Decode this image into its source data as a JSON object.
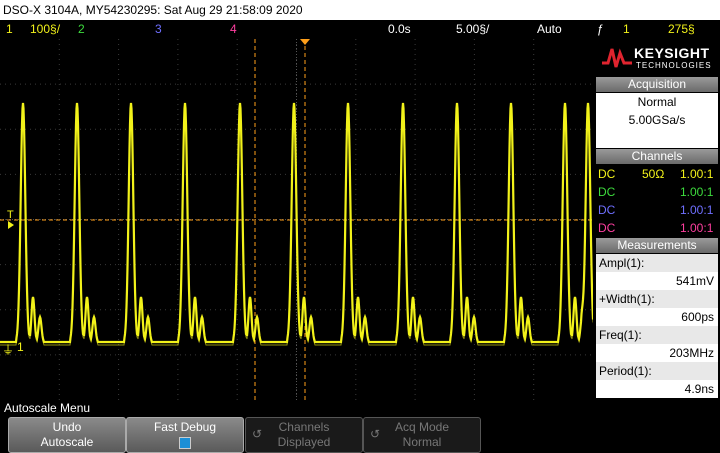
{
  "titlebar": {
    "text": "DSO-X 3104A, MY54230295: Sat Aug 29 21:58:09 2020"
  },
  "status": {
    "ch1_num": "1",
    "ch1_scale": "100§/",
    "ch2_num": "2",
    "ch3_num": "3",
    "ch4_num": "4",
    "delay": "0.0s",
    "timebase": "5.00§/",
    "mode": "Auto",
    "trig_icon": "ƒ",
    "trig_src": "1",
    "trig_level": "275§"
  },
  "colors": {
    "ch1": "#f2f21a",
    "ch2": "#3ddc3d",
    "ch3": "#6f6fff",
    "ch4": "#ff3fa0",
    "orange": "#ff9f1a"
  },
  "screen": {
    "trig_marker": "T",
    "ground_marker": "1"
  },
  "logo": {
    "brand": "KEYSIGHT",
    "sub": "TECHNOLOGIES"
  },
  "acquisition": {
    "title": "Acquisition",
    "mode": "Normal",
    "rate": "5.00GSa/s"
  },
  "channels": {
    "title": "Channels",
    "rows": [
      {
        "coupling": "DC",
        "imp": "50Ω",
        "probe": "1.00:1"
      },
      {
        "coupling": "DC",
        "imp": "",
        "probe": "1.00:1"
      },
      {
        "coupling": "DC",
        "imp": "",
        "probe": "1.00:1"
      },
      {
        "coupling": "DC",
        "imp": "",
        "probe": "1.00:1"
      }
    ]
  },
  "measurements": {
    "title": "Measurements",
    "items": [
      {
        "label": "Ampl(1):",
        "value": "541mV"
      },
      {
        "label": "+Width(1):",
        "value": "600ps"
      },
      {
        "label": "Freq(1):",
        "value": "203MHz"
      },
      {
        "label": "Period(1):",
        "value": "4.9ns"
      }
    ]
  },
  "menu": {
    "title": "Autoscale Menu",
    "keys": [
      {
        "line1": "Undo",
        "line2": "Autoscale"
      },
      {
        "line1": "Fast Debug",
        "line2": ""
      },
      {
        "line1": "Channels",
        "line2": "Displayed"
      },
      {
        "line1": "Acq Mode",
        "line2": "Normal"
      }
    ],
    "circ_icon": "↺"
  }
}
